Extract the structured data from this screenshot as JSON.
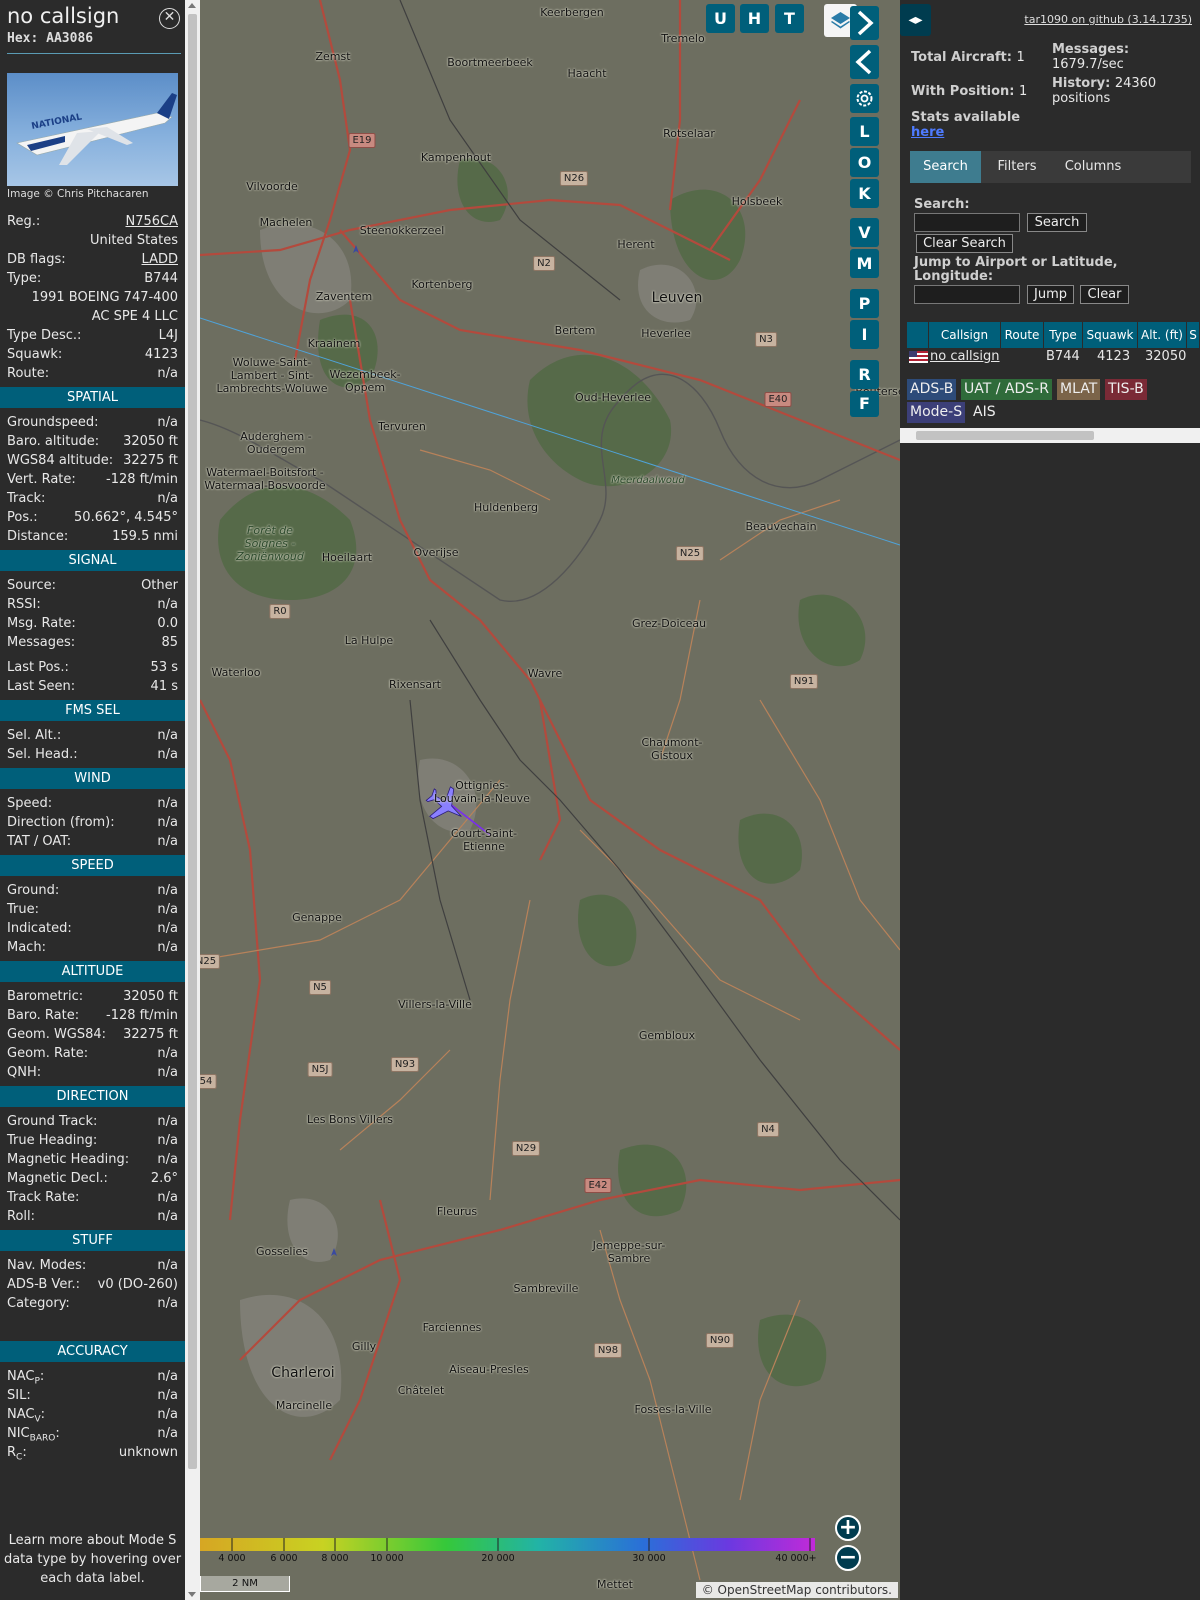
{
  "info": {
    "callsign": "no callsign",
    "hex": "Hex: AA3086",
    "close_icon": "close-icon",
    "photo_credit": "Image © Chris Pitchacaren",
    "photo_livery": "NATIONAL",
    "rows_top": [
      {
        "k": "Reg.:",
        "v": "N756CA",
        "link": true
      },
      {
        "k": "",
        "v": "United States"
      },
      {
        "k": "DB flags:",
        "v": "LADD",
        "link": true
      },
      {
        "k": "Type:",
        "v": "B744"
      },
      {
        "k": "",
        "v": "1991 BOEING 747-400"
      },
      {
        "k": "",
        "v": "AC SPE 4 LLC"
      },
      {
        "k": "Type Desc.:",
        "v": "L4J"
      },
      {
        "k": "Squawk:",
        "v": "4123"
      },
      {
        "k": "Route:",
        "v": "n/a"
      }
    ],
    "sections": [
      {
        "title": "SPATIAL",
        "rows": [
          {
            "k": "Groundspeed:",
            "v": "n/a"
          },
          {
            "k": "Baro. altitude:",
            "v": "32050 ft"
          },
          {
            "k": "WGS84 altitude:",
            "v": "32275 ft"
          },
          {
            "k": "Vert. Rate:",
            "v": "-128 ft/min"
          },
          {
            "k": "Track:",
            "v": "n/a"
          },
          {
            "k": "Pos.:",
            "v": "50.662°, 4.545°"
          },
          {
            "k": "Distance:",
            "v": "159.5 nmi"
          }
        ]
      },
      {
        "title": "SIGNAL",
        "rows": [
          {
            "k": "Source:",
            "v": "Other"
          },
          {
            "k": "RSSI:",
            "v": "n/a"
          },
          {
            "k": "Msg. Rate:",
            "v": "0.0"
          },
          {
            "k": "Messages:",
            "v": "85"
          },
          {
            "k": "Last Pos.:",
            "v": "53 s"
          },
          {
            "k": "Last Seen:",
            "v": "41 s"
          }
        ]
      },
      {
        "title": "FMS SEL",
        "rows": [
          {
            "k": "Sel. Alt.:",
            "v": "n/a"
          },
          {
            "k": "Sel. Head.:",
            "v": "n/a"
          }
        ]
      },
      {
        "title": "WIND",
        "rows": [
          {
            "k": "Speed:",
            "v": "n/a"
          },
          {
            "k": "Direction (from):",
            "v": "n/a"
          },
          {
            "k": "TAT / OAT:",
            "v": "n/a"
          }
        ]
      },
      {
        "title": "SPEED",
        "rows": [
          {
            "k": "Ground:",
            "v": "n/a"
          },
          {
            "k": "True:",
            "v": "n/a"
          },
          {
            "k": "Indicated:",
            "v": "n/a"
          },
          {
            "k": "Mach:",
            "v": "n/a"
          }
        ]
      },
      {
        "title": "ALTITUDE",
        "rows": [
          {
            "k": "Barometric:",
            "v": "32050 ft"
          },
          {
            "k": "Baro. Rate:",
            "v": "-128 ft/min"
          },
          {
            "k": "Geom. WGS84:",
            "v": "32275 ft"
          },
          {
            "k": "Geom. Rate:",
            "v": "n/a"
          },
          {
            "k": "QNH:",
            "v": "n/a"
          }
        ]
      },
      {
        "title": "DIRECTION",
        "rows": [
          {
            "k": "Ground Track:",
            "v": "n/a"
          },
          {
            "k": "True Heading:",
            "v": "n/a"
          },
          {
            "k": "Magnetic Heading:",
            "v": "n/a"
          },
          {
            "k": "Magnetic Decl.:",
            "v": "2.6°"
          },
          {
            "k": "Track Rate:",
            "v": "n/a"
          },
          {
            "k": "Roll:",
            "v": "n/a"
          }
        ]
      },
      {
        "title": "STUFF",
        "rows": [
          {
            "k": "Nav. Modes:",
            "v": "n/a"
          },
          {
            "k": "ADS-B Ver.:",
            "v": "v0 (DO-260)"
          },
          {
            "k": "Category:",
            "v": "n/a"
          }
        ]
      },
      {
        "title": "ACCURACY",
        "rows": [
          {
            "k": "NACP:",
            "v": "n/a"
          },
          {
            "k": "SIL:",
            "v": "n/a"
          },
          {
            "k": "NACV:",
            "v": "n/a"
          },
          {
            "k": "NICBARO:",
            "v": "n/a"
          },
          {
            "k": "RC:",
            "v": "unknown"
          }
        ]
      }
    ],
    "learn_more": "Learn more about Mode S data type by hovering over each data label."
  },
  "map": {
    "buttons_top": [
      "U",
      "H",
      "T"
    ],
    "side_buttons": [
      "L",
      "O",
      "K",
      "V",
      "M",
      "P",
      "I",
      "R",
      "F"
    ],
    "layers_icon": "layers-icon",
    "settings_icon": "gear-icon",
    "next_icon": "chevron-right-icon",
    "prev_icon": "chevron-left-icon",
    "zoom_in": "+",
    "zoom_out": "−",
    "scale_label": "2 NM",
    "attribution": "© OpenStreetMap contributors.",
    "colorbar_ticks": [
      "4 000",
      "6 000",
      "8 000",
      "10 000",
      "20 000",
      "30 000",
      "40 000+"
    ],
    "places": [
      "Keerbergen",
      "Tremelo",
      "Zemst",
      "Boortmeerbeek",
      "Haacht",
      "Rotselaar",
      "Kampenhout",
      "Vilvoorde",
      "Machelen",
      "Steenokkerzeel",
      "Herent",
      "Holsbeek",
      "Zaventem",
      "Kortenberg",
      "Leuven",
      "Kraainem",
      "Bertem",
      "Heverlee",
      "Woluwe-Saint-Lambert - Sint-Lambrechts-Woluwe",
      "Wezembeek-Oppem",
      "Tervuren",
      "Oud-Heverlee",
      "Auderghem - Oudergem",
      "Watermael-Boitsfort - Watermaal-Bosvoorde",
      "Huldenberg",
      "Beauvechain",
      "Forêt de Soignes - Zoniënwoud",
      "Hoeilaart",
      "Overijse",
      "Meerdaalwoud",
      "Grez-Doiceau",
      "La Hulpe",
      "Rixensart",
      "Wavre",
      "Waterloo",
      "Chaumont-Gistoux",
      "Ottignies-Louvain-la-Neuve",
      "Court-Saint-Etienne",
      "Genappe",
      "Villers-la-Ville",
      "Gembloux",
      "Les Bons Villers",
      "Fleurus",
      "Gosselies",
      "Jemeppe-sur-Sambre",
      "Sambreville",
      "Farciennes",
      "Gilly",
      "Aiseau-Presles",
      "Charleroi",
      "Châtelet",
      "Marcinelle",
      "Fosses-la-Ville",
      "Mettet",
      "Bouterse"
    ],
    "road_shields": [
      "E19",
      "N26",
      "N2",
      "N3",
      "E40",
      "N25",
      "R0",
      "N91",
      "N5",
      "N5J",
      "N93",
      "N29",
      "E42",
      "N4",
      "N98",
      "N90",
      "N25",
      "54"
    ]
  },
  "side": {
    "toggle_icon": "expand-horizontal-icon",
    "version": "tar1090 on github (3.14.1735)",
    "total_aircraft_label": "Total Aircraft:",
    "total_aircraft": "1",
    "with_position_label": "With Position:",
    "with_position": "1",
    "messages_label": "Messages:",
    "messages": "1679.7/sec",
    "history_label": "History:",
    "history": "24360 positions",
    "stats_label": "Stats available",
    "stats_link": "here",
    "tabs": [
      "Search",
      "Filters",
      "Columns"
    ],
    "search_label": "Search:",
    "search_button": "Search",
    "clear_search_button": "Clear Search",
    "jump_label": "Jump to Airport or Latitude, Longitude:",
    "jump_button": "Jump",
    "clear_button": "Clear",
    "table_headers": [
      "Callsign",
      "Route",
      "Type",
      "Squawk",
      "Alt. (ft)",
      "S"
    ],
    "table_row": {
      "flag": "us-flag-icon",
      "callsign": "no callsign",
      "route": "",
      "type": "B744",
      "squawk": "4123",
      "alt": "32050"
    },
    "source_badges": [
      {
        "label": "ADS-B",
        "color": "#2d4b79"
      },
      {
        "label": "UAT / ADS-R",
        "color": "#2f6b3a"
      },
      {
        "label": "MLAT",
        "color": "#7b6449"
      },
      {
        "label": "TIS-B",
        "color": "#7a2a36"
      },
      {
        "label": "Mode-S",
        "color": "#3c3f78"
      },
      {
        "label": "AIS",
        "color": "#2b2b2b"
      }
    ]
  }
}
